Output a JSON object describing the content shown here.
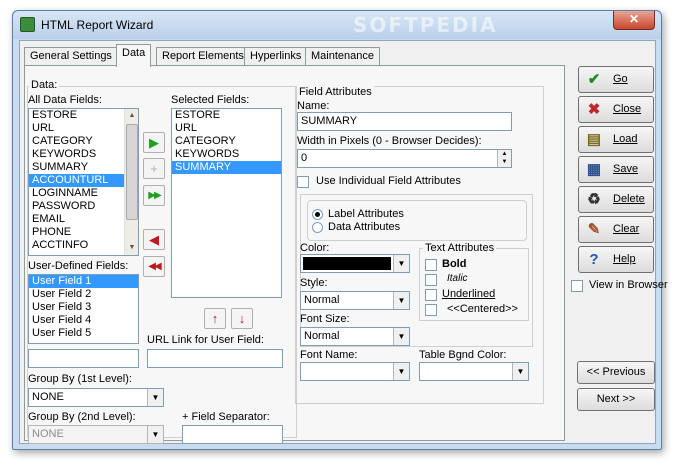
{
  "window": {
    "title": "HTML Report Wizard",
    "watermark": "SOFTPEDIA",
    "close": "✕"
  },
  "tabs": [
    "General Settings",
    "Data",
    "Report Elements",
    "Hyperlinks",
    "Maintenance"
  ],
  "data_group": {
    "label": "Data:",
    "all_fields_label": "All Data Fields:",
    "all_fields": [
      "ESTORE",
      "URL",
      "CATEGORY",
      "KEYWORDS",
      "SUMMARY",
      "ACCOUNTURL",
      "LOGINNAME",
      "PASSWORD",
      "EMAIL",
      "PHONE",
      "ACCTINFO"
    ],
    "all_fields_selected": "ACCOUNTURL",
    "selected_fields_label": "Selected Fields:",
    "selected_fields": [
      "ESTORE",
      "URL",
      "CATEGORY",
      "KEYWORDS",
      "SUMMARY"
    ],
    "selected_fields_selected": "SUMMARY",
    "user_defined_label": "User-Defined Fields:",
    "user_defined": [
      "User Field 1",
      "User Field 2",
      "User Field 3",
      "User Field 4",
      "User Field 5"
    ],
    "user_defined_selected": "User Field 1",
    "user_field_value": "",
    "url_link_label": "URL Link for User Field:",
    "url_link_value": "",
    "group_by_1_label": "Group By (1st Level):",
    "group_by_1_value": "NONE",
    "group_by_2_label": "Group By (2nd Level):",
    "group_by_2_value": "NONE",
    "field_separator_label": "+ Field Separator:",
    "field_separator_value": ""
  },
  "arrows": {
    "add": "▶",
    "add_disabled": "+",
    "add_all": "▶▶",
    "remove": "◀",
    "remove_all": "◀◀",
    "move_up": "↑",
    "move_down": "↓"
  },
  "field_attributes": {
    "label": "Field Attributes",
    "name_label": "Name:",
    "name_value": "SUMMARY",
    "width_label": "Width in Pixels (0 - Browser Decides):",
    "width_value": "0",
    "use_individual_label": "Use Individual Field Attributes",
    "use_individual_checked": false,
    "radio_label_attrs": "Label Attributes",
    "radio_data_attrs": "Data Attributes",
    "color_label": "Color:",
    "color_value": "#000000",
    "style_label": "Style:",
    "style_value": "Normal",
    "font_size_label": "Font Size:",
    "font_size_value": "Normal",
    "font_name_label": "Font Name:",
    "font_name_value": "",
    "text_attrs_label": "Text Attributes",
    "bold_label": "Bold",
    "italic_label": "Italic",
    "underlined_label": "Underlined",
    "centered_label": "<<Centered>>",
    "table_bgnd_label": "Table Bgnd Color:",
    "table_bgnd_value": ""
  },
  "side_buttons": [
    {
      "label": "Go",
      "icon": "check-icon",
      "glyph": "✔",
      "color": "#1f8a1f"
    },
    {
      "label": "Close",
      "icon": "x-icon",
      "glyph": "✖",
      "color": "#c0282a"
    },
    {
      "label": "Load",
      "icon": "document-icon",
      "glyph": "▤",
      "color": "#7a6a1a"
    },
    {
      "label": "Save",
      "icon": "save-icon",
      "glyph": "▦",
      "color": "#2a4f8a"
    },
    {
      "label": "Delete",
      "icon": "trash-icon",
      "glyph": "♻",
      "color": "#333333"
    },
    {
      "label": "Clear",
      "icon": "brush-icon",
      "glyph": "✎",
      "color": "#a0522d"
    },
    {
      "label": "Help",
      "icon": "question-icon",
      "glyph": "?",
      "color": "#1e5aa8"
    }
  ],
  "view_in_browser": {
    "label": "View in Browser",
    "checked": false
  },
  "nav": {
    "previous": "<< Previous",
    "next": "Next >>"
  }
}
